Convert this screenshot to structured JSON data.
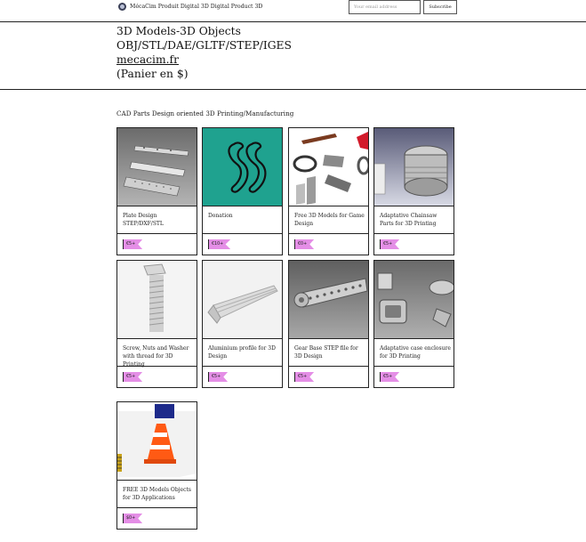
{
  "topbar": {
    "brand_text": "MécaCim Produit Digital 3D Digital Product 3D",
    "email_placeholder": "Your email address",
    "subscribe_label": "Subscribe"
  },
  "header": {
    "line1": "3D Models-3D Objects",
    "line2": "OBJ/STL/DAE/GLTF/STEP/IGES",
    "link": "mecacim.fr",
    "line4": "(Panier en $)"
  },
  "tagline": "CAD Parts Design oriented 3D Printing/Manufacturing",
  "products": [
    {
      "title": "Plate Design STEP/DXF/STL",
      "price": "€5+"
    },
    {
      "title": "Donation",
      "price": "€10+"
    },
    {
      "title": "Free 3D Models for Game Design",
      "price": "€0+"
    },
    {
      "title": "Adaptative Chainsaw Parts for 3D Printing",
      "price": "€5+"
    },
    {
      "title": "Screw, Nuts and Washer with thread for 3D Printing",
      "price": "€5+"
    },
    {
      "title": "Aluminium profile for 3D Design",
      "price": "€5+"
    },
    {
      "title": "Gear Base STEP file for 3D Design",
      "price": "€5+"
    },
    {
      "title": "Adaptative case enclosure for 3D Printing",
      "price": "€5+"
    },
    {
      "title": "FREE 3D Models Objects for 3D Applications",
      "price": "$0+"
    }
  ],
  "colors": {
    "price_tag": "#e48ee6",
    "donation_bg": "#1fa28f"
  },
  "icons": [
    "site-logo-icon"
  ]
}
